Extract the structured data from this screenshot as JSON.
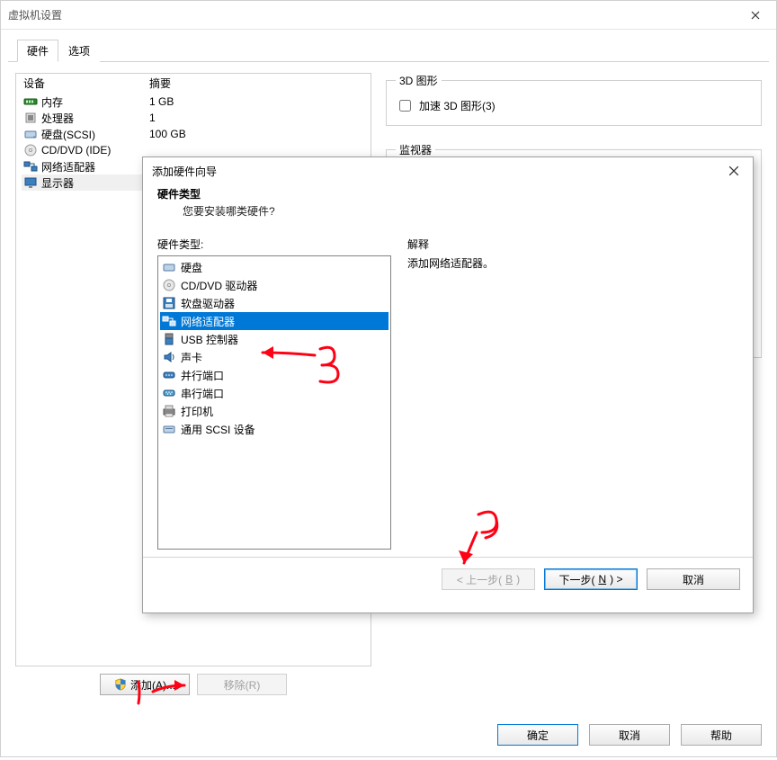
{
  "window": {
    "title": "虚拟机设置"
  },
  "tabs": {
    "hardware": "硬件",
    "options": "选项"
  },
  "devlist": {
    "col_device": "设备",
    "col_summary": "摘要",
    "items": [
      {
        "name": "内存",
        "summary": "1 GB",
        "icon": "memory"
      },
      {
        "name": "处理器",
        "summary": "1",
        "icon": "cpu"
      },
      {
        "name": "硬盘(SCSI)",
        "summary": "100 GB",
        "icon": "hdd"
      },
      {
        "name": "CD/DVD (IDE)",
        "summary": "",
        "icon": "cd"
      },
      {
        "name": "网络适配器",
        "summary": "",
        "icon": "net"
      },
      {
        "name": "显示器",
        "summary": "",
        "icon": "display"
      }
    ],
    "add_btn": "添加(A)...",
    "remove_btn": "移除(R)"
  },
  "right": {
    "graphics_legend": "3D 图形",
    "accel_3d": "加速 3D 图形(3)",
    "monitors_legend": "监视器"
  },
  "wizard": {
    "title": "添加硬件向导",
    "heading": "硬件类型",
    "subheading": "您要安装哪类硬件?",
    "hwtype_label": "硬件类型:",
    "explain_label": "解释",
    "explain_text": "添加网络适配器。",
    "items": [
      {
        "name": "硬盘",
        "icon": "hdd"
      },
      {
        "name": "CD/DVD 驱动器",
        "icon": "cd"
      },
      {
        "name": "软盘驱动器",
        "icon": "floppy"
      },
      {
        "name": "网络适配器",
        "icon": "net"
      },
      {
        "name": "USB 控制器",
        "icon": "usb"
      },
      {
        "name": "声卡",
        "icon": "sound"
      },
      {
        "name": "并行端口",
        "icon": "parallel"
      },
      {
        "name": "串行端口",
        "icon": "serial"
      },
      {
        "name": "打印机",
        "icon": "printer"
      },
      {
        "name": "通用 SCSI 设备",
        "icon": "scsi"
      }
    ],
    "back_pre": "< 上一步(",
    "back_key": "B",
    "back_post": ")",
    "next_pre": "下一步(",
    "next_key": "N",
    "next_post": ") >",
    "cancel": "取消"
  },
  "buttons": {
    "ok": "确定",
    "cancel": "取消",
    "help": "帮助"
  },
  "annotations": {
    "n1": "1",
    "n2": "2",
    "n3": "3"
  }
}
